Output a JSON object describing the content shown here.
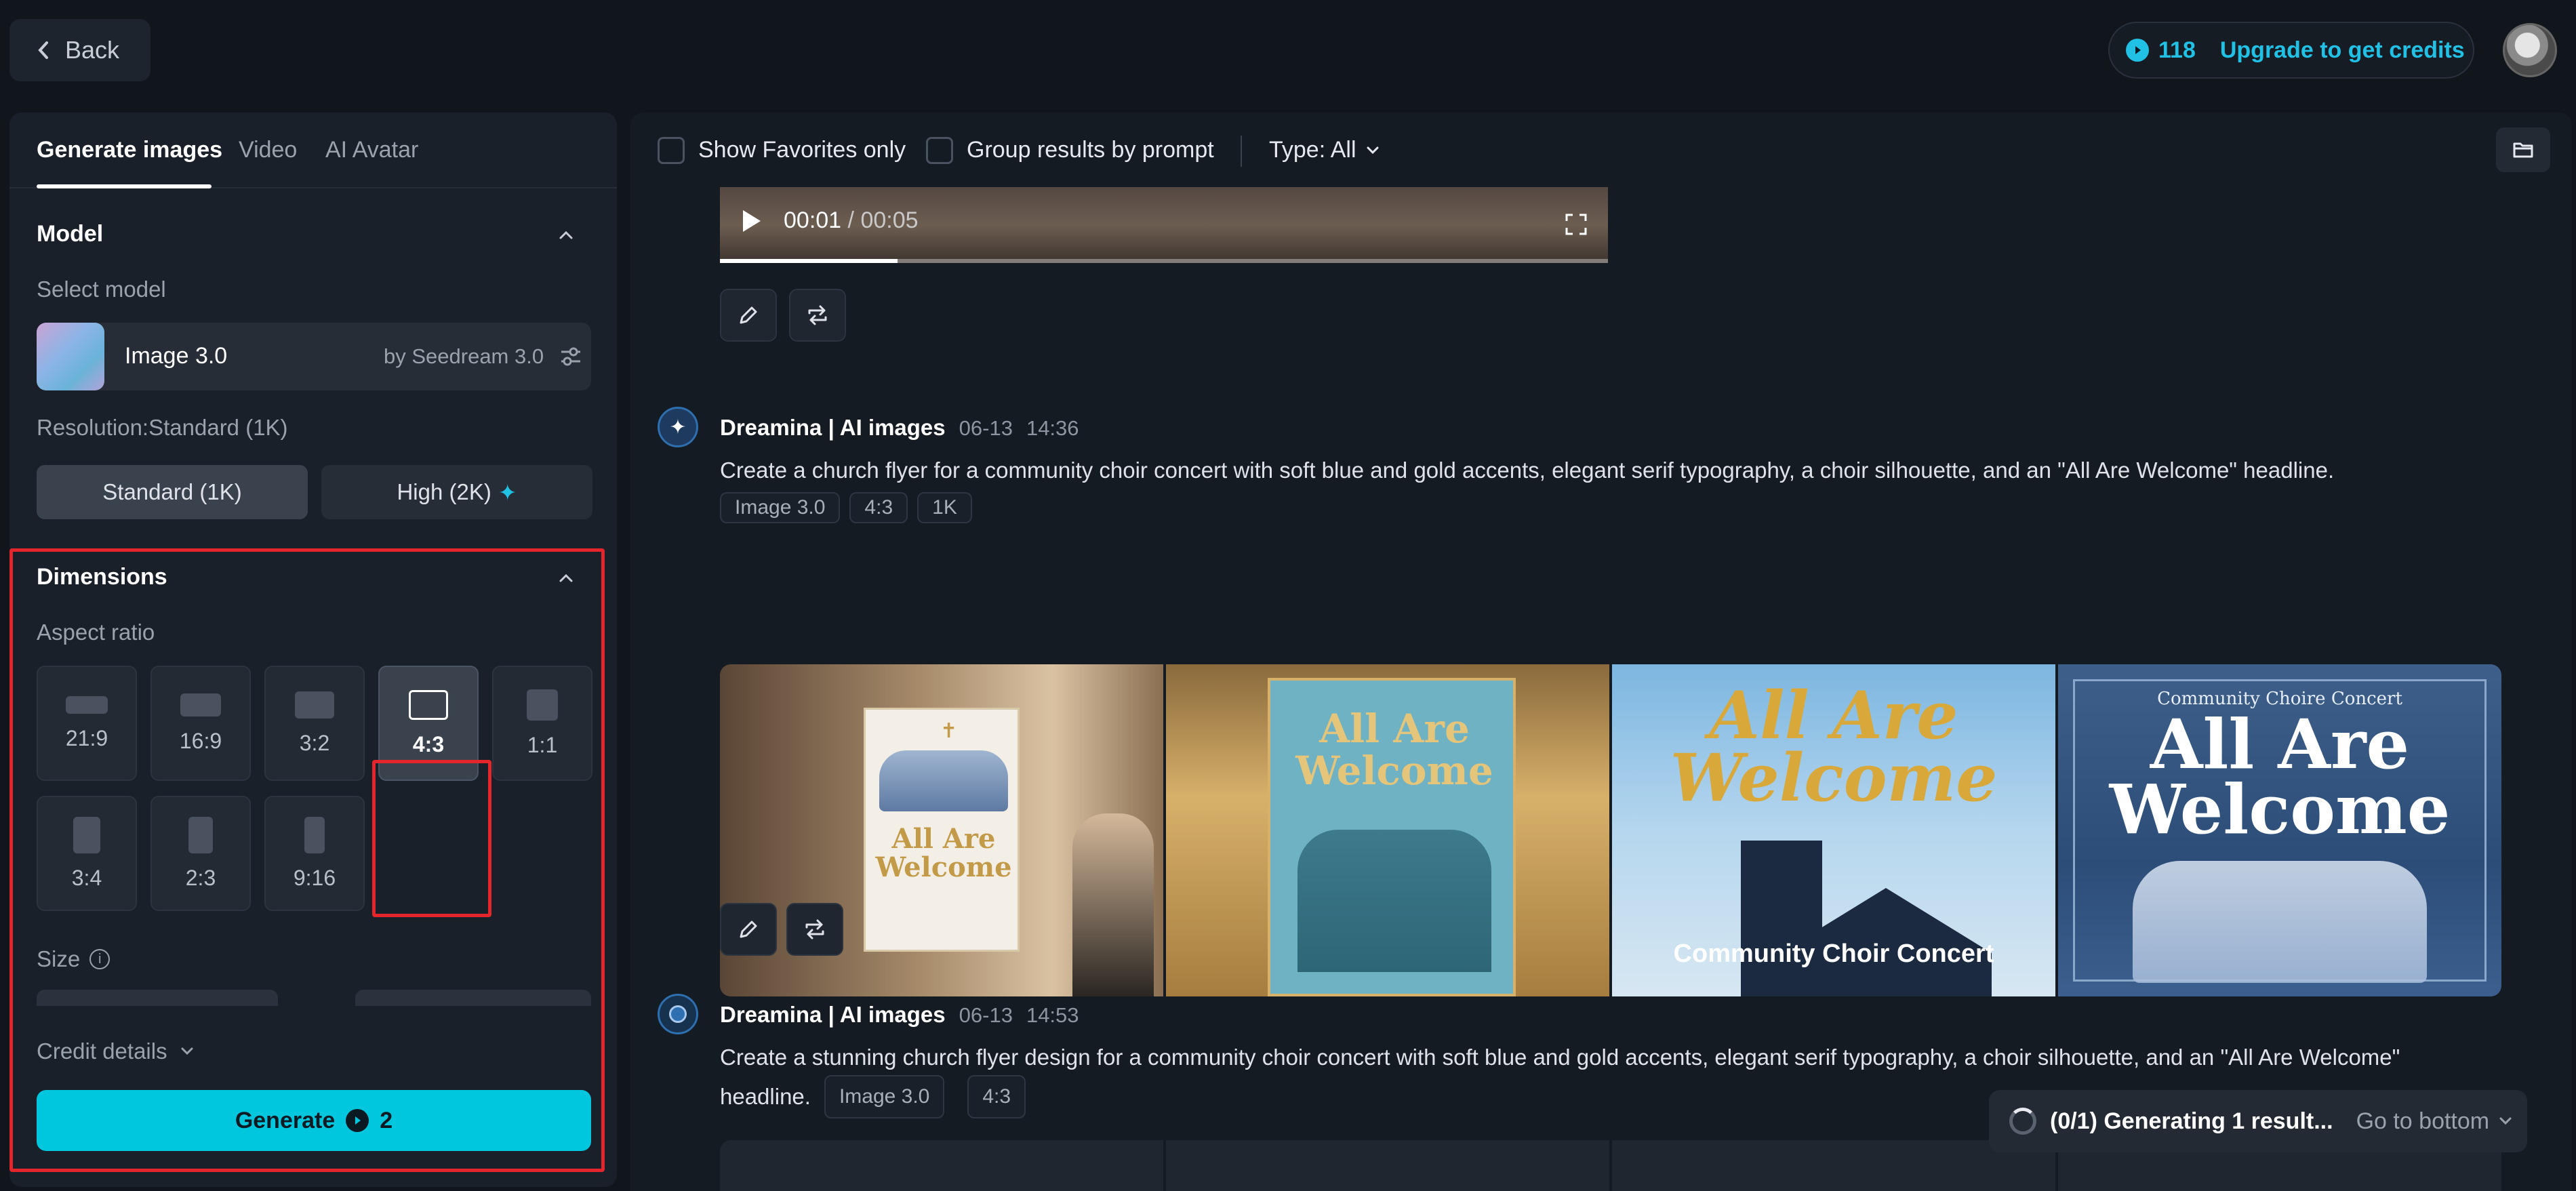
{
  "header": {
    "back_label": "Back",
    "credits": "118",
    "upgrade_label": "Upgrade to get credits"
  },
  "left": {
    "tabs": [
      {
        "label": "Generate images",
        "active": true
      },
      {
        "label": "Video"
      },
      {
        "label": "AI Avatar"
      }
    ],
    "model": {
      "section_title": "Model",
      "select_label": "Select model",
      "name": "Image 3.0",
      "by": "by Seedream 3.0"
    },
    "resolution": {
      "label": "Resolution:Standard (1K)",
      "options": [
        "Standard (1K)",
        "High (2K)"
      ],
      "selected": "Standard (1K)"
    },
    "dimensions": {
      "section_title": "Dimensions",
      "aspect_label": "Aspect ratio",
      "ratios": [
        "21:9",
        "16:9",
        "3:2",
        "4:3",
        "1:1",
        "3:4",
        "2:3",
        "9:16"
      ],
      "selected": "4:3",
      "size_label": "Size"
    },
    "credit_details_label": "Credit details",
    "generate_label": "Generate",
    "generate_cost": "2"
  },
  "right": {
    "filters": {
      "favorites_label": "Show Favorites only",
      "group_label": "Group results by prompt",
      "type_label": "Type: All"
    },
    "video": {
      "current": "00:01",
      "total": "/ 00:05",
      "progress": 0.2
    },
    "generations": [
      {
        "name": "Dreamina | AI images",
        "date": "06-13",
        "time": "14:36",
        "prompt": "Create a church flyer for a community choir concert with soft blue and gold accents, elegant serif typography, a choir silhouette, and an \"All Are Welcome\" headline.",
        "chips": [
          "Image 3.0",
          "4:3",
          "1K"
        ],
        "images": [
          {
            "line1": "All Are",
            "line2": "Welcome"
          },
          {
            "line1": "All Are",
            "line2": "Welcome"
          },
          {
            "line1": "All Are",
            "line2": "Welcome",
            "caption": "Community Choir Concert"
          },
          {
            "line1": "All Are",
            "line2": "Welcome",
            "top": "Community Choire Concert"
          }
        ]
      },
      {
        "name": "Dreamina | AI images",
        "date": "06-13",
        "time": "14:53",
        "prompt_line1": "Create a stunning church flyer design for a community choir concert with soft blue and gold accents, elegant serif typography, a choir silhouette, and an \"All Are Welcome\"",
        "prompt_line2": "headline.",
        "chips": [
          "Image 3.0",
          "4:3"
        ]
      }
    ],
    "toast": {
      "status": "(0/1) Generating 1 result...",
      "goto": "Go to bottom"
    }
  }
}
